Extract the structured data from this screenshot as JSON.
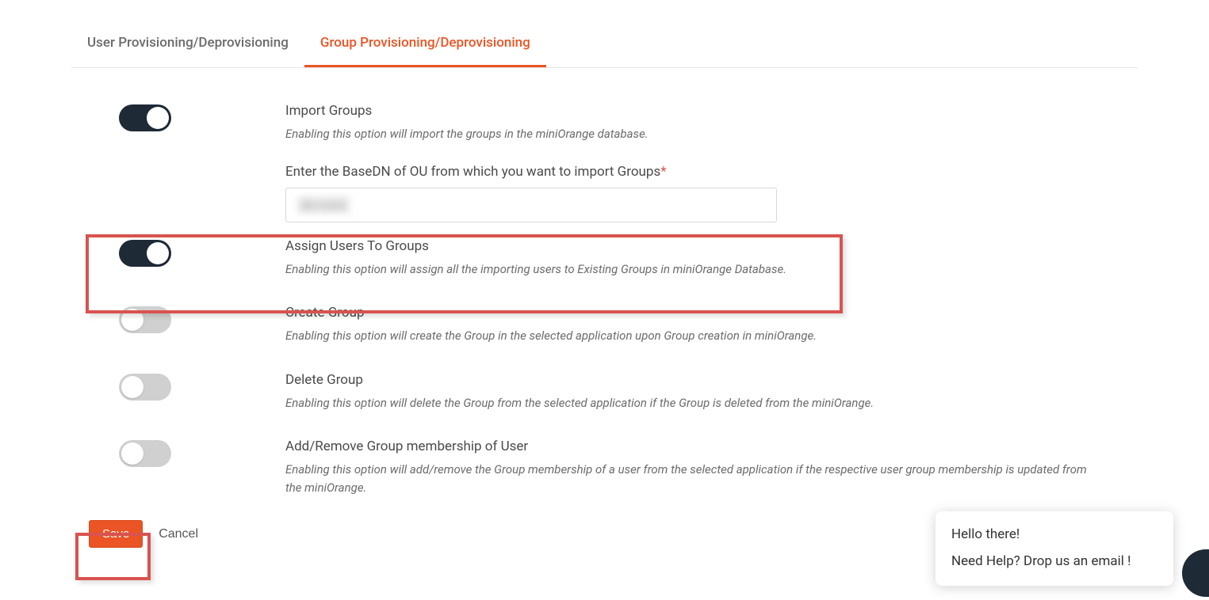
{
  "tabs": {
    "user": "User Provisioning/Deprovisioning",
    "group": "Group Provisioning/Deprovisioning"
  },
  "options": {
    "import": {
      "title": "Import Groups",
      "desc": "Enabling this option will import the groups in the miniOrange database.",
      "on": true
    },
    "basedn": {
      "label": "Enter the BaseDN of OU from which you want to import Groups",
      "value": "dc=com"
    },
    "assign": {
      "title": "Assign Users To Groups",
      "desc": "Enabling this option will assign all the importing users to Existing Groups in miniOrange Database.",
      "on": true
    },
    "create": {
      "title": "Create Group",
      "desc": "Enabling this option will create the Group in the selected application upon Group creation in miniOrange.",
      "on": false
    },
    "delete": {
      "title": "Delete Group",
      "desc": "Enabling this option will delete the Group from the selected application if the Group is deleted from the miniOrange.",
      "on": false
    },
    "membership": {
      "title": "Add/Remove Group membership of User",
      "desc": "Enabling this option will add/remove the Group membership of a user from the selected application if the respective user group membership is updated from the miniOrange.",
      "on": false
    }
  },
  "footer": {
    "save": "Save",
    "cancel": "Cancel"
  },
  "chat": {
    "line1": "Hello there!",
    "line2": "Need Help? Drop us an email !"
  }
}
